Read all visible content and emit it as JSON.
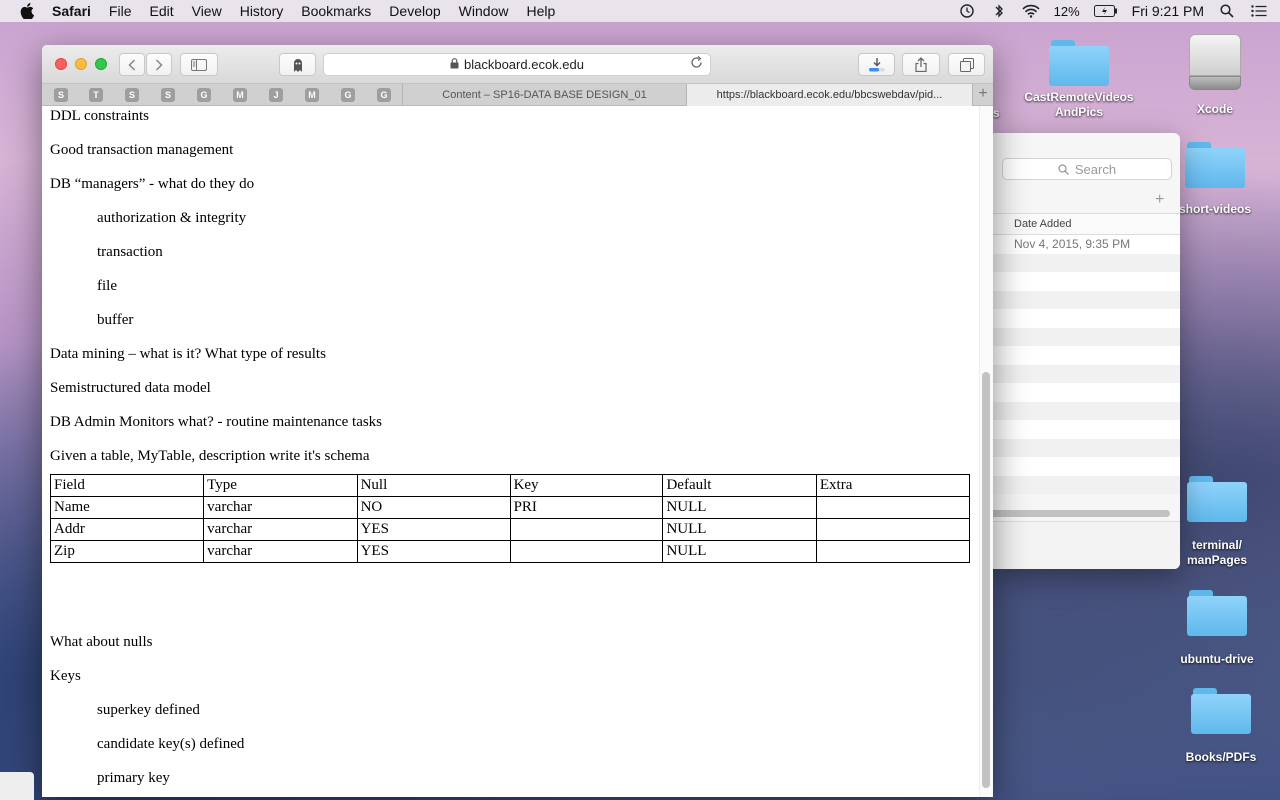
{
  "menubar": {
    "app_name": "Safari",
    "items": [
      "File",
      "Edit",
      "View",
      "History",
      "Bookmarks",
      "Develop",
      "Window",
      "Help"
    ],
    "battery": "12%",
    "clock": "Fri 9:21 PM"
  },
  "desktop": {
    "icons": [
      {
        "label": "CastRemoteVideos AndPics"
      },
      {
        "label": "Xcode"
      },
      {
        "label": "short-videos"
      },
      {
        "label": "terminal/ manPages"
      },
      {
        "label": "ubuntu-drive"
      },
      {
        "label": "Books/PDFs"
      }
    ],
    "partial_label": "s"
  },
  "finder": {
    "search_placeholder": "Search",
    "column_header": "Date Added",
    "first_row_date": "Nov 4, 2015, 9:35 PM"
  },
  "safari": {
    "address": "blackboard.ecok.edu",
    "tabs": [
      {
        "title": "Content – SP16-DATA BASE DESIGN_01"
      },
      {
        "title": "https://blackboard.ecok.edu/bbcswebdav/pid..."
      }
    ],
    "pinned": [
      "S",
      "T",
      "S",
      "S",
      "G",
      "M",
      "J",
      "M",
      "G",
      "G"
    ]
  },
  "document": {
    "lines": [
      "DDL constraints",
      "Good transaction management",
      "DB “managers” - what do they do",
      "authorization & integrity",
      "transaction",
      "file",
      "buffer",
      "Data mining – what is it? What type of results",
      "Semistructured data model",
      "DB Admin Monitors what? - routine maintenance tasks",
      "Given a table, MyTable, description write it's schema"
    ],
    "table": {
      "headers": [
        "Field",
        "Type",
        "Null",
        "Key",
        "Default",
        "Extra"
      ],
      "rows": [
        [
          "Name",
          "varchar",
          "NO",
          "PRI",
          "NULL",
          ""
        ],
        [
          "Addr",
          "varchar",
          "YES",
          "",
          "NULL",
          ""
        ],
        [
          "Zip",
          "varchar",
          "YES",
          "",
          "NULL",
          ""
        ]
      ]
    },
    "after_lines": [
      "What about nulls",
      "Keys",
      "superkey defined",
      "candidate key(s) defined",
      "primary key"
    ]
  }
}
